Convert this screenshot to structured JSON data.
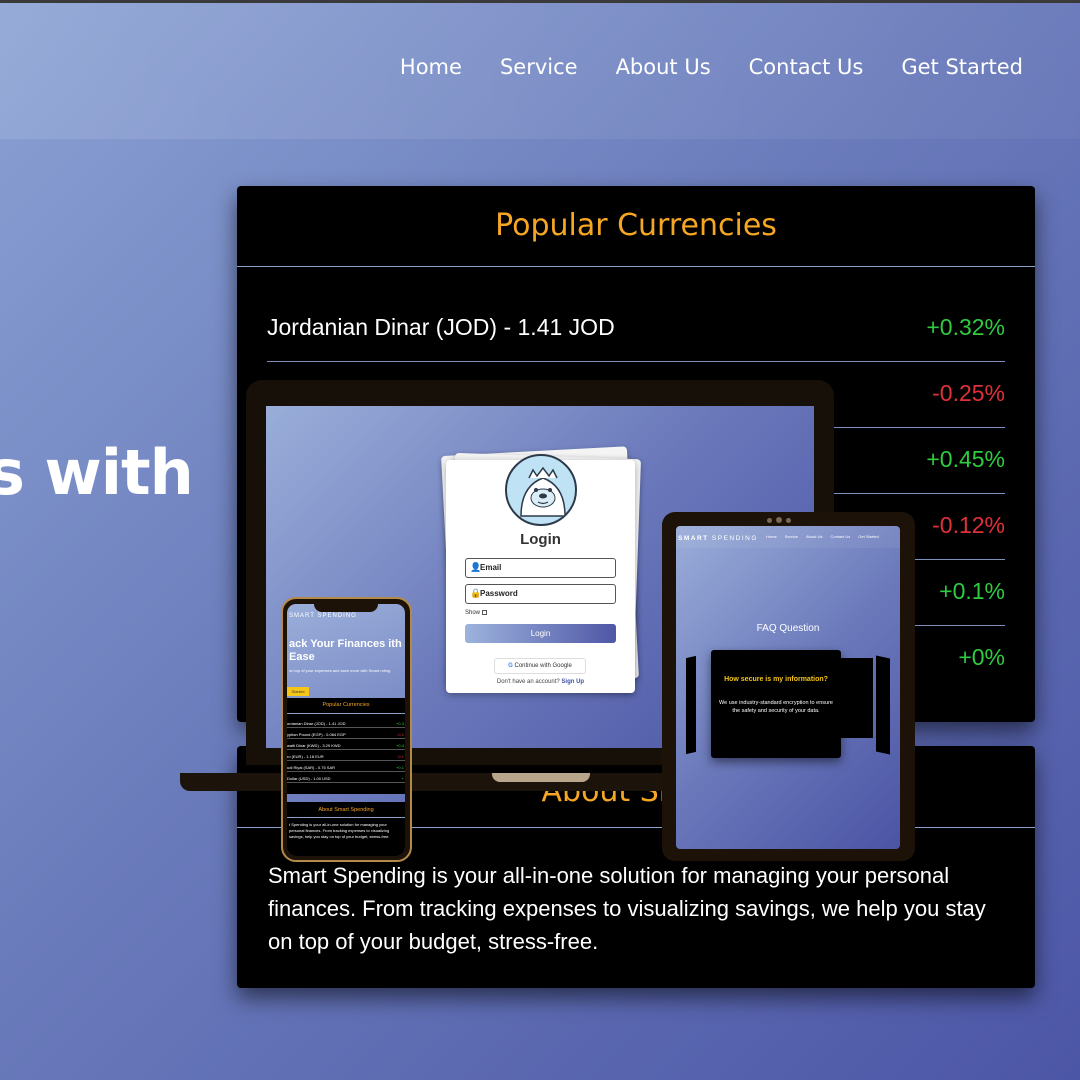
{
  "nav": {
    "links": [
      "Home",
      "Service",
      "About Us",
      "Contact Us",
      "Get Started"
    ]
  },
  "hero": {
    "text_fragment": "s with"
  },
  "currencies": {
    "title": "Popular Currencies",
    "rows": [
      {
        "name": "Jordanian Dinar (JOD) - 1.41 JOD",
        "change": "+0.32%"
      },
      {
        "name": "",
        "change": "-0.25%"
      },
      {
        "name": "",
        "change": "+0.45%"
      },
      {
        "name": "",
        "change": "-0.12%"
      },
      {
        "name": "",
        "change": "+0.1%"
      },
      {
        "name": "",
        "change": "+0%"
      }
    ],
    "colors": {
      "positive": "#2ecc40",
      "negative": "#e0303a",
      "title": "#f5a623"
    }
  },
  "about": {
    "title": "About Smart",
    "body": "Smart Spending is your all-in-one solution for managing your personal finances. From tracking expenses to visualizing savings, we help you stay on top of your budget, stress-free."
  },
  "laptop": {
    "login": {
      "title": "Login",
      "email_placeholder": "Email",
      "password_placeholder": "Password",
      "show_label": "Show",
      "login_button": "Login",
      "google_button": "Continue with Google",
      "signup_prompt": "Don't have an account?",
      "signup_link": "Sign Up"
    }
  },
  "phone": {
    "brand": "SMART SPENDING",
    "hero_title": "ack Your Finances ith Ease",
    "hero_sub": "on top of your expenses and save more with Smart nding.",
    "hero_button": "Started",
    "currencies_title": "Popular Currencies",
    "rows": [
      {
        "name": "ordanian Dinar (JOD) - 1.41 JOD",
        "change": "+0.3"
      },
      {
        "name": "yptian Pound (EGP) - 0.064 EGP",
        "change": "-0.2"
      },
      {
        "name": "waiti Dinar (KWD) - 3.29 KWD",
        "change": "+0.4"
      },
      {
        "name": "ro (EUR) - 1.18 EUR",
        "change": "-0.1"
      },
      {
        "name": "udi Riyal (SAR) - 0.75 SAR",
        "change": "+0.1"
      },
      {
        "name": "Dollar (USD) - 1.00 USD",
        "change": "+"
      }
    ],
    "about_title": "About Smart Spending",
    "about_body": "t Spending is your all-in-one solution for managing your personal finances. From tracking expenses to visualizing savings, help you stay on top of your budget, stress-free."
  },
  "tablet": {
    "brand_bold": "SMART",
    "brand_rest": "SPENDING",
    "links": [
      "Home",
      "Service",
      "About Us",
      "Contact Us",
      "Get Started"
    ],
    "faq_title": "FAQ Question",
    "question": "How secure is my information?",
    "answer": "We use industry-standard encryption to ensure the safety and security of your data."
  }
}
